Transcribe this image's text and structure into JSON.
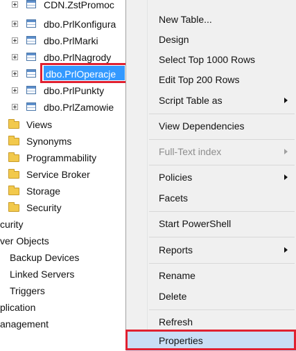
{
  "tree": {
    "tables": [
      {
        "label": "CDN.ZstPromoc"
      },
      {
        "label": "dbo.PrlKonfigura"
      },
      {
        "label": "dbo.PrlMarki"
      },
      {
        "label": "dbo.PrlNagrody"
      },
      {
        "label": "dbo.PrlOperacje",
        "selected": true
      },
      {
        "label": "dbo.PrlPunkty"
      },
      {
        "label": "dbo.PrlZamowie"
      }
    ],
    "folders": [
      {
        "label": "Views"
      },
      {
        "label": "Synonyms"
      },
      {
        "label": "Programmability"
      },
      {
        "label": "Service Broker"
      },
      {
        "label": "Storage"
      },
      {
        "label": "Security"
      }
    ],
    "server_nodes": [
      {
        "label": "curity"
      },
      {
        "label": "ver Objects"
      },
      {
        "label": "Backup Devices"
      },
      {
        "label": "Linked Servers"
      },
      {
        "label": "Triggers"
      },
      {
        "label": "plication"
      },
      {
        "label": "anagement"
      }
    ]
  },
  "context_menu": {
    "items": [
      {
        "label": "New Table..."
      },
      {
        "label": "Design"
      },
      {
        "label": "Select Top 1000 Rows"
      },
      {
        "label": "Edit Top 200 Rows"
      },
      {
        "label": "Script Table as",
        "submenu": true
      },
      {
        "label": "View Dependencies"
      },
      {
        "label": "Full-Text index",
        "submenu": true,
        "disabled": true
      },
      {
        "label": "Policies",
        "submenu": true
      },
      {
        "label": "Facets"
      },
      {
        "label": "Start PowerShell"
      },
      {
        "label": "Reports",
        "submenu": true
      },
      {
        "label": "Rename"
      },
      {
        "label": "Delete"
      },
      {
        "label": "Refresh"
      },
      {
        "label": "Properties",
        "highlighted": true
      }
    ]
  },
  "colors": {
    "selection": "#3399ff",
    "callout_border": "#e02030",
    "menu_background": "#f0f0f0"
  }
}
